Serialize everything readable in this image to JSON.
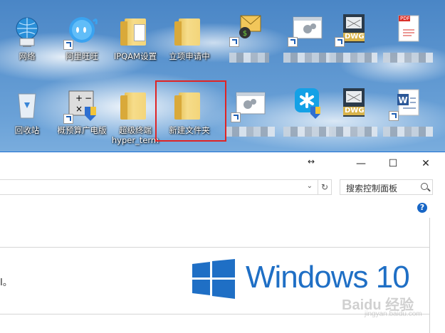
{
  "desktop": {
    "icons": [
      {
        "label": "网络"
      },
      {
        "label": "阿里旺旺"
      },
      {
        "label": "IPQAM设置"
      },
      {
        "label": "立项申请中"
      },
      {
        "label": "回收站"
      },
      {
        "label": "概预算广电版"
      },
      {
        "label": "超级终端",
        "label2": "hyper_term"
      },
      {
        "label": "新建文件夹"
      }
    ],
    "dwg_text": "DWG",
    "pdf_text": "PDF"
  },
  "window": {
    "title_controls": {
      "minimize": "—",
      "maximize": "☐",
      "close": "✕",
      "resize": "↔"
    },
    "search_placeholder": "搜索控制面板",
    "help_label": "?",
    "left_text": "I。",
    "brand": "Windows 10",
    "watermark": "Baidu 经验",
    "watermark_sub": "jingyan.baidu.com"
  }
}
